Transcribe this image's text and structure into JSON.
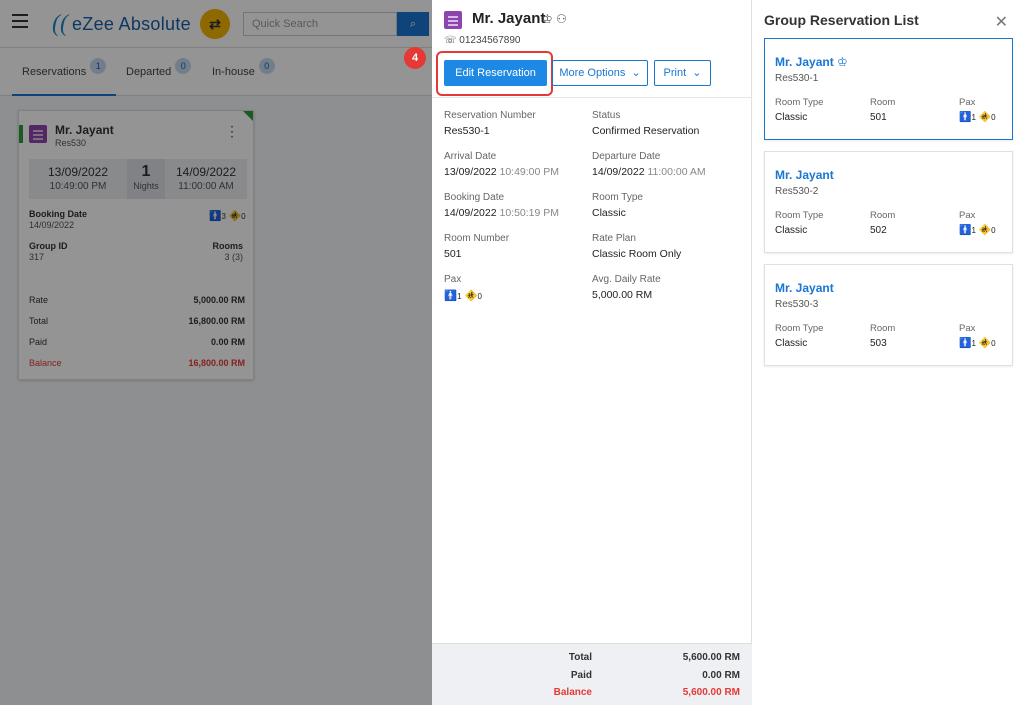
{
  "topbar": {
    "logo_text": "eZee Absolute",
    "search_placeholder": "Quick Search"
  },
  "tabs": [
    {
      "label": "Reservations",
      "count": "1"
    },
    {
      "label": "Departed",
      "count": "0"
    },
    {
      "label": "In-house",
      "count": "0"
    }
  ],
  "card": {
    "name": "Mr. Jayant",
    "res_id": "Res530",
    "arrival_date": "13/09/2022",
    "arrival_time": "10:49:00 PM",
    "nights": "1",
    "nights_label": "Nights",
    "departure_date": "14/09/2022",
    "departure_time": "11:00:00 AM",
    "booking_date_label": "Booking Date",
    "booking_date": "14/09/2022",
    "pax_adults": "3",
    "pax_children": "0",
    "group_id_label": "Group ID",
    "group_id": "317",
    "rooms_label": "Rooms",
    "rooms": "3 (3)",
    "rate_label": "Rate",
    "rate": "5,000.00 RM",
    "total_label": "Total",
    "total": "16,800.00 RM",
    "paid_label": "Paid",
    "paid": "0.00 RM",
    "balance_label": "Balance",
    "balance": "16,800.00 RM"
  },
  "step_badge": "4",
  "detail": {
    "name": "Mr. Jayant",
    "phone": "01234567890",
    "edit_label": "Edit Reservation",
    "more_label": "More Options",
    "print_label": "Print",
    "fields": {
      "res_number_label": "Reservation Number",
      "res_number": "Res530-1",
      "status_label": "Status",
      "status": "Confirmed Reservation",
      "arrival_label": "Arrival Date",
      "arrival_date": "13/09/2022",
      "arrival_time": "10:49:00 PM",
      "departure_label": "Departure Date",
      "departure_date": "14/09/2022",
      "departure_time": "11:00:00 AM",
      "booking_label": "Booking Date",
      "booking_date": "14/09/2022",
      "booking_time": "10:50:19 PM",
      "room_type_label": "Room Type",
      "room_type": "Classic",
      "room_number_label": "Room Number",
      "room_number": "501",
      "rate_plan_label": "Rate Plan",
      "rate_plan": "Classic Room Only",
      "pax_label": "Pax",
      "pax_adults": "1",
      "pax_children": "0",
      "adr_label": "Avg. Daily Rate",
      "adr": "5,000.00 RM"
    },
    "footer": {
      "total_label": "Total",
      "total": "5,600.00 RM",
      "paid_label": "Paid",
      "paid": "0.00 RM",
      "balance_label": "Balance",
      "balance": "5,600.00 RM"
    }
  },
  "group": {
    "title": "Group Reservation List",
    "room_type_label": "Room Type",
    "room_label": "Room",
    "pax_label": "Pax",
    "items": [
      {
        "name": "Mr. Jayant",
        "res": "Res530-1",
        "room_type": "Classic",
        "room": "501",
        "adults": "1",
        "children": "0"
      },
      {
        "name": "Mr. Jayant",
        "res": "Res530-2",
        "room_type": "Classic",
        "room": "502",
        "adults": "1",
        "children": "0"
      },
      {
        "name": "Mr. Jayant",
        "res": "Res530-3",
        "room_type": "Classic",
        "room": "503",
        "adults": "1",
        "children": "0"
      }
    ]
  },
  "colors": {
    "accent": "#1976d2",
    "edit_button": "#1e88e5",
    "highlight": "#e53935",
    "status_green": "#2e9e3e",
    "room_icon": "#8e44ad"
  }
}
